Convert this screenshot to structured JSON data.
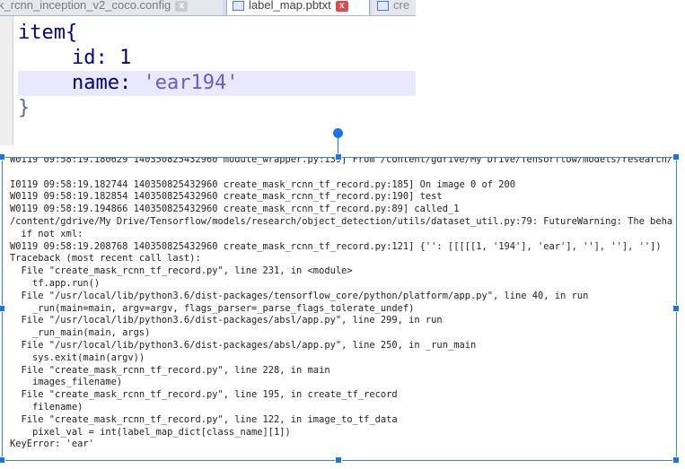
{
  "tabs": [
    {
      "label": "k_rcnn_inception_v2_coco.config",
      "close": "x"
    },
    {
      "label": "label_map.pbtxt",
      "close": "x"
    },
    {
      "label": "cre"
    }
  ],
  "editor": {
    "lines": [
      "item{",
      "id: 1",
      "name: ",
      "'ear194'",
      "}"
    ]
  },
  "console": {
    "lines": [
      "W0119 09:58:19.180629 140350825432960 module_wrapper.py:139] From /content/gdrive/My Drive/Tensorflow/models/research/",
      "",
      "I0119 09:58:19.182744 140350825432960 create_mask_rcnn_tf_record.py:185] On image 0 of 200",
      "W0119 09:58:19.182854 140350825432960 create_mask_rcnn_tf_record.py:190] test",
      "W0119 09:58:19.194866 140350825432960 create_mask_rcnn_tf_record.py:89] called_1",
      "/content/gdrive/My Drive/Tensorflow/models/research/object_detection/utils/dataset_util.py:79: FutureWarning: The beha",
      "  if not xml:",
      "W0119 09:58:19.208768 140350825432960 create_mask_rcnn_tf_record.py:121] {'': [[[[[1, '194'], 'ear'], ''], ''], ''])",
      "Traceback (most recent call last):",
      "  File \"create_mask_rcnn_tf_record.py\", line 231, in <module>",
      "    tf.app.run()",
      "  File \"/usr/local/lib/python3.6/dist-packages/tensorflow_core/python/platform/app.py\", line 40, in run",
      "    _run(main=main, argv=argv, flags_parser=_parse_flags_tolerate_undef)",
      "  File \"/usr/local/lib/python3.6/dist-packages/absl/app.py\", line 299, in run",
      "    _run_main(main, args)",
      "  File \"/usr/local/lib/python3.6/dist-packages/absl/app.py\", line 250, in _run_main",
      "    sys.exit(main(argv))",
      "  File \"create_mask_rcnn_tf_record.py\", line 228, in main",
      "    images_filename)",
      "  File \"create_mask_rcnn_tf_record.py\", line 195, in create_tf_record",
      "    filename)",
      "  File \"create_mask_rcnn_tf_record.py\", line 122, in image_to_tf_data",
      "    pixel_val = int(label_map_dict[class_name][1])",
      "KeyError: 'ear'"
    ]
  },
  "colors": {
    "selection": "#1a73e8",
    "highlight_line": "#e8e8ff",
    "code_text": "#000080"
  }
}
